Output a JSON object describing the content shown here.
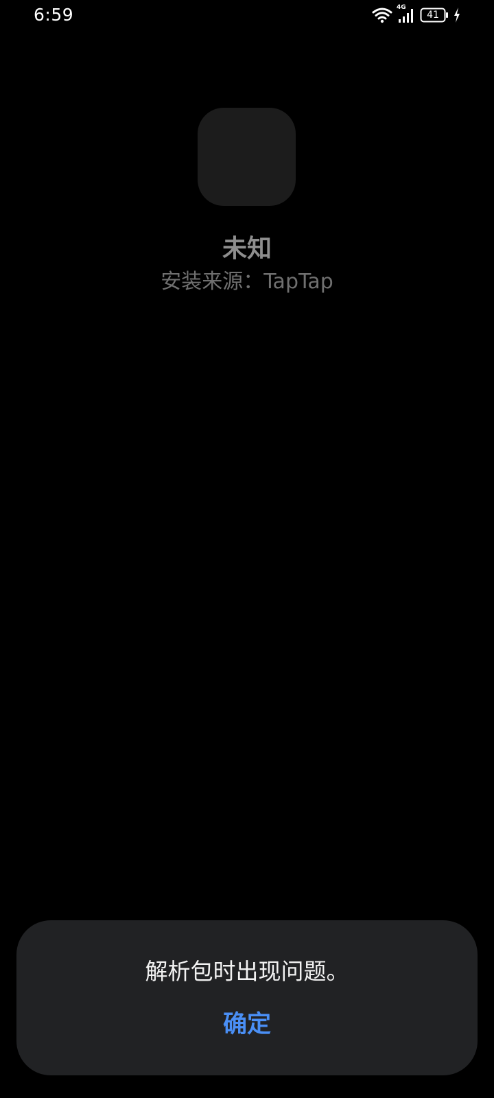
{
  "status_bar": {
    "time": "6:59",
    "network_type": "4G",
    "battery_level": "41",
    "icons": [
      "wifi-icon",
      "cellular-signal-icon",
      "battery-icon",
      "charging-bolt-icon"
    ]
  },
  "app": {
    "name": "未知",
    "source": "安装来源：TapTap"
  },
  "dialog": {
    "message": "解析包时出现问题。",
    "confirm_label": "确定",
    "accent_color": "#4a8ff5"
  }
}
